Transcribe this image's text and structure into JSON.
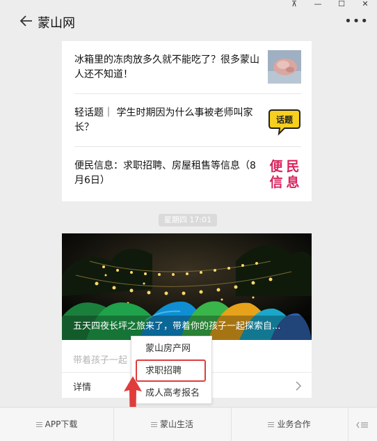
{
  "window": {
    "pin_label": "⊼",
    "minimize_label": "—",
    "maximize_label": "☐",
    "close_label": "✕"
  },
  "header": {
    "title": "蒙山网",
    "more_label": "•••"
  },
  "articles": [
    {
      "title": "冰箱里的冻肉放多久就不能吃了？很多蒙山人还不知道！",
      "thumb": "frozen-meat-photo"
    },
    {
      "title": "轻话题｜ 学生时期因为什么事被老师叫家长？",
      "thumb": "speech-bubble-icon",
      "thumb_text": "话题"
    },
    {
      "title": "便民信息：求职招聘、房屋租售等信息（8月6日）",
      "thumb": "bianmin-xinxi-logo",
      "thumb_text": [
        "便",
        "民",
        "信",
        "息"
      ]
    }
  ],
  "timestamp": "星期四 17:01",
  "feature": {
    "title": "五天四夜长坪之旅来了，带着你的孩子一起探索自...",
    "subtitle": "带着孩子一起",
    "detail_label": "详情"
  },
  "popup_menu": {
    "items": [
      "蒙山房产网",
      "求职招聘",
      "成人高考报名"
    ],
    "highlighted_index": 1
  },
  "bottom_menu": {
    "items": [
      "APP下载",
      "蒙山生活",
      "业务合作"
    ],
    "keyboard_icon": "keyboard-toggle-icon"
  },
  "colors": {
    "highlight": "#e03c3c",
    "bianmin": "#d9245d",
    "bubble": "#f6cf1f"
  }
}
